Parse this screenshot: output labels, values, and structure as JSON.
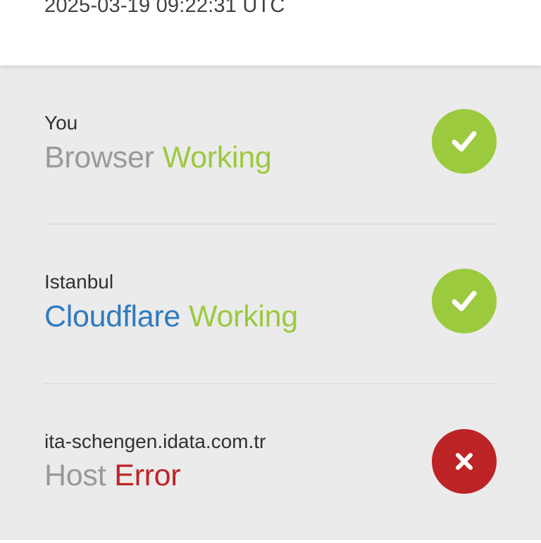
{
  "header": {
    "timestamp": "2025-03-19 09:22:31 UTC"
  },
  "rows": [
    {
      "location": "You",
      "name": "Browser",
      "status": "Working",
      "icon": "check-icon",
      "state_color": "#9bca3e"
    },
    {
      "location": "Istanbul",
      "name": "Cloudflare",
      "status": "Working",
      "icon": "check-icon",
      "state_color": "#9bca3e"
    },
    {
      "location": "ita-schengen.idata.com.tr",
      "name": "Host",
      "status": "Error",
      "icon": "x-icon",
      "state_color": "#bd2426"
    }
  ],
  "colors": {
    "ok": "#9bca3e",
    "error": "#bd2426",
    "cloudflare_blue": "#2f7bbf",
    "muted_gray": "#999999",
    "panel_bg": "#ebebeb"
  }
}
